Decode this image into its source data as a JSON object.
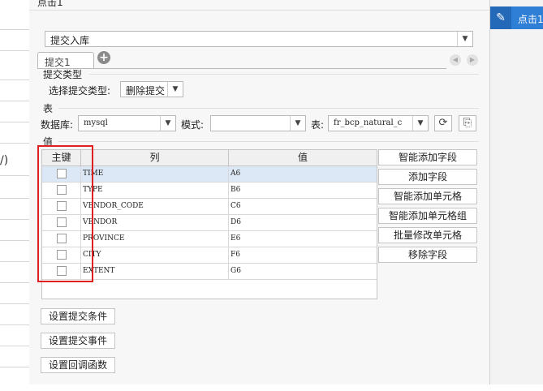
{
  "window": {
    "title": "点击1"
  },
  "right_panel": {
    "event_label": "点击1"
  },
  "background": {
    "left_fragment": "/)"
  },
  "submit": {
    "type_value": "提交入库"
  },
  "tabs": [
    {
      "label": "提交1"
    }
  ],
  "submit_type": {
    "section": "提交类型",
    "label": "选择提交类型:",
    "value": "删除提交"
  },
  "table_section": {
    "section": "表",
    "db_label": "数据库:",
    "db_value": "mysql",
    "schema_label": "模式:",
    "schema_value": "",
    "table_label": "表:",
    "table_value": "fr_bcp_natural_c"
  },
  "values": {
    "section": "值",
    "columns": [
      "主键",
      "列",
      "值"
    ],
    "rows": [
      {
        "column": "TIME",
        "value": "A6"
      },
      {
        "column": "TYPE",
        "value": "B6"
      },
      {
        "column": "VENDOR_CODE",
        "value": "C6"
      },
      {
        "column": "VENDOR",
        "value": "D6"
      },
      {
        "column": "PROVINCE",
        "value": "E6"
      },
      {
        "column": "CITY",
        "value": "F6"
      },
      {
        "column": "EXTENT",
        "value": "G6"
      }
    ]
  },
  "side_buttons": [
    "智能添加字段",
    "添加字段",
    "智能添加单元格",
    "智能添加单元格组",
    "批量修改单元格",
    "移除字段"
  ],
  "bottom_buttons": [
    "设置提交条件",
    "设置提交事件",
    "设置回调函数"
  ],
  "icons": {
    "refresh": "refresh-icon",
    "preview": "preview-icon",
    "add_tab": "plus-icon",
    "edit": "pencil-icon"
  },
  "colors": {
    "accent": "#2f7fd6",
    "highlight_box": "#e02020",
    "selected_row": "#dce8f5"
  }
}
